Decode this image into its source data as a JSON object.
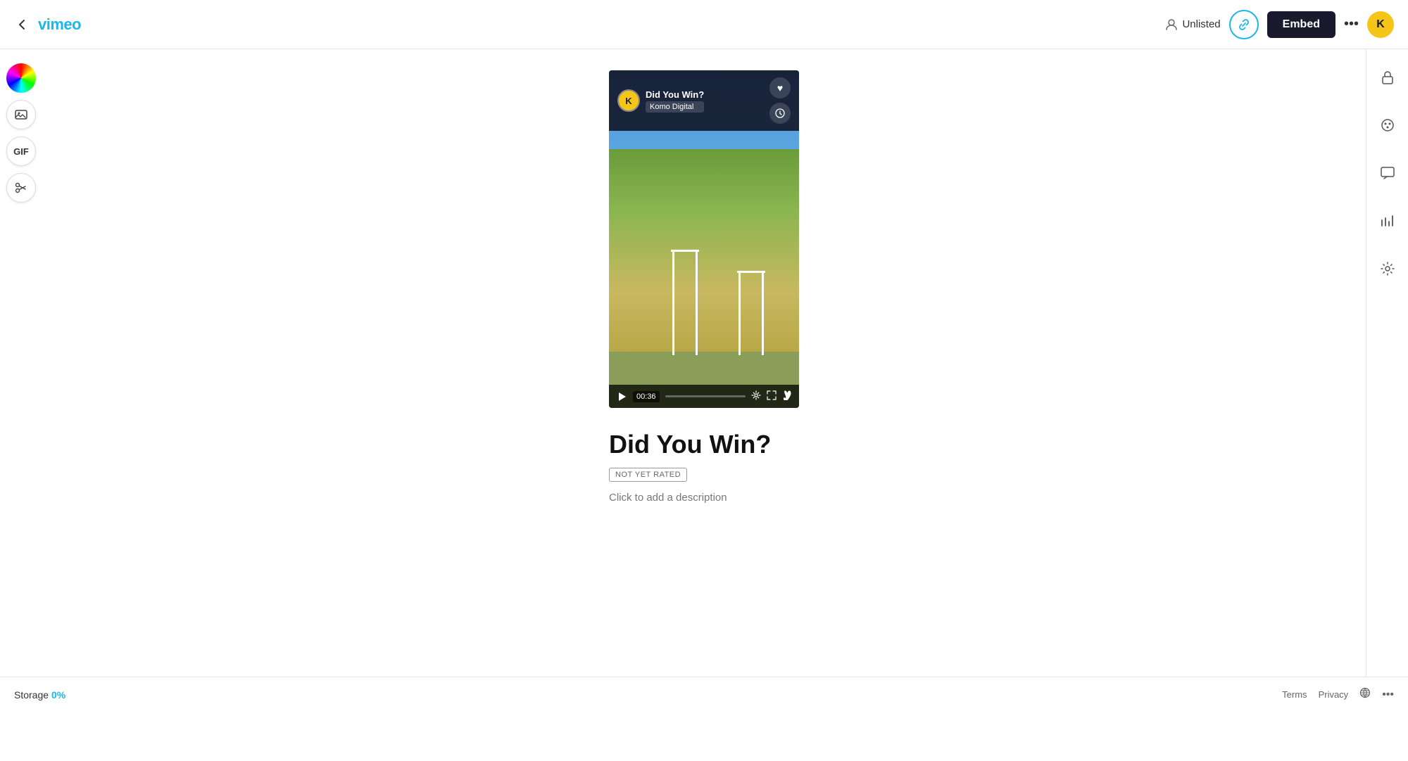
{
  "header": {
    "back_label": "←",
    "logo": "vimeo",
    "unlisted_label": "Unlisted",
    "link_icon": "🔗",
    "embed_label": "Embed",
    "more_icon": "•••",
    "user_initial": "K"
  },
  "left_toolbar": {
    "color_wheel_label": "color wheel",
    "image_label": "image tool",
    "gif_label": "GIF",
    "scissors_label": "trim/cut"
  },
  "video": {
    "title_overlay": "Did You Win?",
    "channel": "Komo Digital",
    "komo_initial": "K",
    "time_display": "00:36",
    "heart_icon": "♥",
    "clock_icon": "🕐"
  },
  "video_info": {
    "title": "Did You Win?",
    "rating": "NOT YET RATED",
    "description_placeholder": "Click to add a description"
  },
  "right_sidebar": {
    "lock_icon": "🔒",
    "palette_icon": "🎨",
    "comment_icon": "💬",
    "analytics_icon": "📊",
    "settings_icon": "⚙"
  },
  "footer": {
    "storage_label": "Storage",
    "storage_pct": "0%",
    "terms_label": "Terms",
    "privacy_label": "Privacy",
    "more_icon": "•••"
  }
}
